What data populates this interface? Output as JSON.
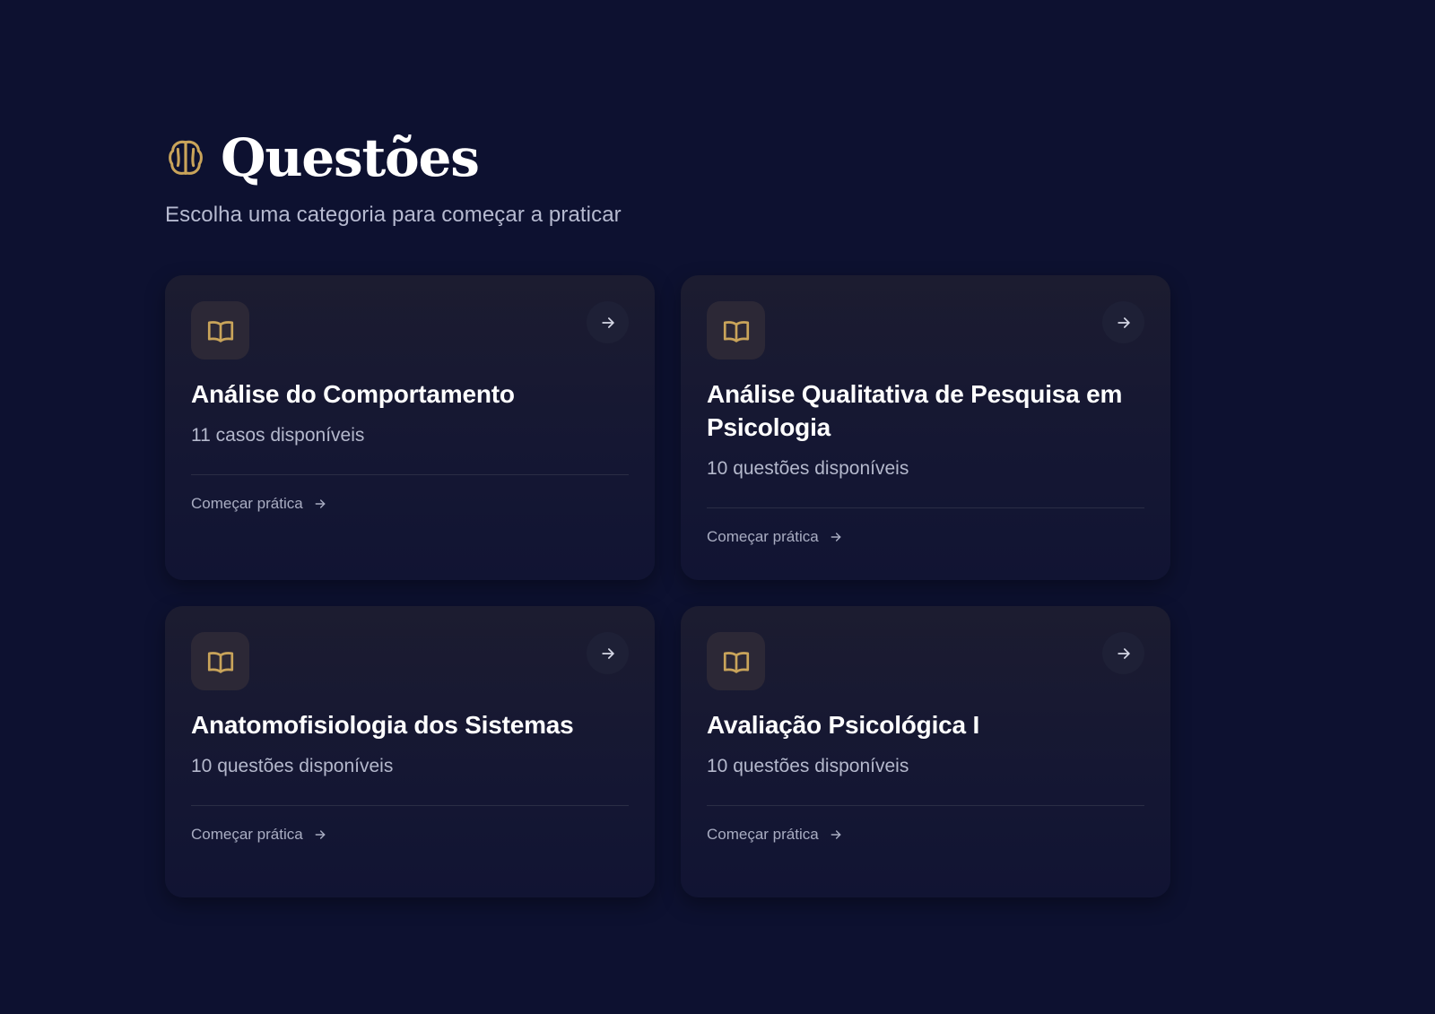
{
  "header": {
    "icon": "brain-icon",
    "title": "Questões",
    "subtitle": "Escolha uma categoria para começar a praticar"
  },
  "colors": {
    "background": "#0d1130",
    "accent": "#c9a45a",
    "card": "#16182f"
  },
  "categories": [
    {
      "title": "Análise do Comportamento",
      "count": "11 casos disponíveis",
      "cta": "Começar prática",
      "icon": "book-open-icon"
    },
    {
      "title": "Análise Qualitativa de Pesquisa em Psicologia",
      "count": "10 questões disponíveis",
      "cta": "Começar prática",
      "icon": "book-open-icon"
    },
    {
      "title": "Anatomofisiologia dos Sistemas",
      "count": "10 questões disponíveis",
      "cta": "Começar prática",
      "icon": "book-open-icon"
    },
    {
      "title": "Avaliação Psicológica I",
      "count": "10 questões disponíveis",
      "cta": "Começar prática",
      "icon": "book-open-icon"
    }
  ]
}
